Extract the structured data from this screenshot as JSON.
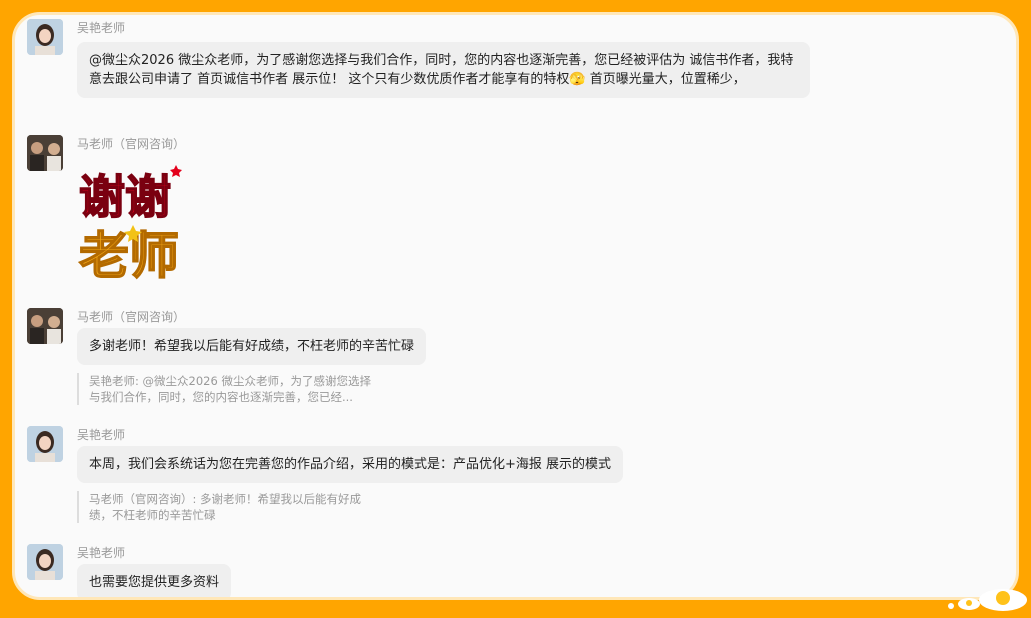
{
  "messages": [
    {
      "sender": "吴艳老师",
      "text": "@微尘众2026  微尘众老师，为了感谢您选择与我们合作，同时，您的内容也逐渐完善，您已经被评估为 诚信书作者，我特意去跟公司申请了 首页诚信书作者 展示位！ 这个只有少数优质作者才能享有的特权🫣 首页曝光量大，位置稀少，"
    },
    {
      "sender": "马老师（官网咨询）",
      "sticker": "谢谢老师"
    },
    {
      "sender": "马老师（官网咨询）",
      "text": "多谢老师！希望我以后能有好成绩，不枉老师的辛苦忙碌",
      "quote": "吴艳老师: @微尘众2026  微尘众老师，为了感谢您选择与我们合作，同时，您的内容也逐渐完善，您已经..."
    },
    {
      "sender": "吴艳老师",
      "text": "本周，我们会系统话为您在完善您的作品介绍，采用的模式是：产品优化+海报 展示的模式",
      "quote": "马老师（官网咨询）: 多谢老师！希望我以后能有好成绩，不枉老师的辛苦忙碌"
    },
    {
      "sender": "吴艳老师",
      "text": "也需要您提供更多资料"
    }
  ],
  "colors": {
    "frame_border": "#FFA500",
    "bubble": "#EFEFEF",
    "sender": "#999999"
  }
}
